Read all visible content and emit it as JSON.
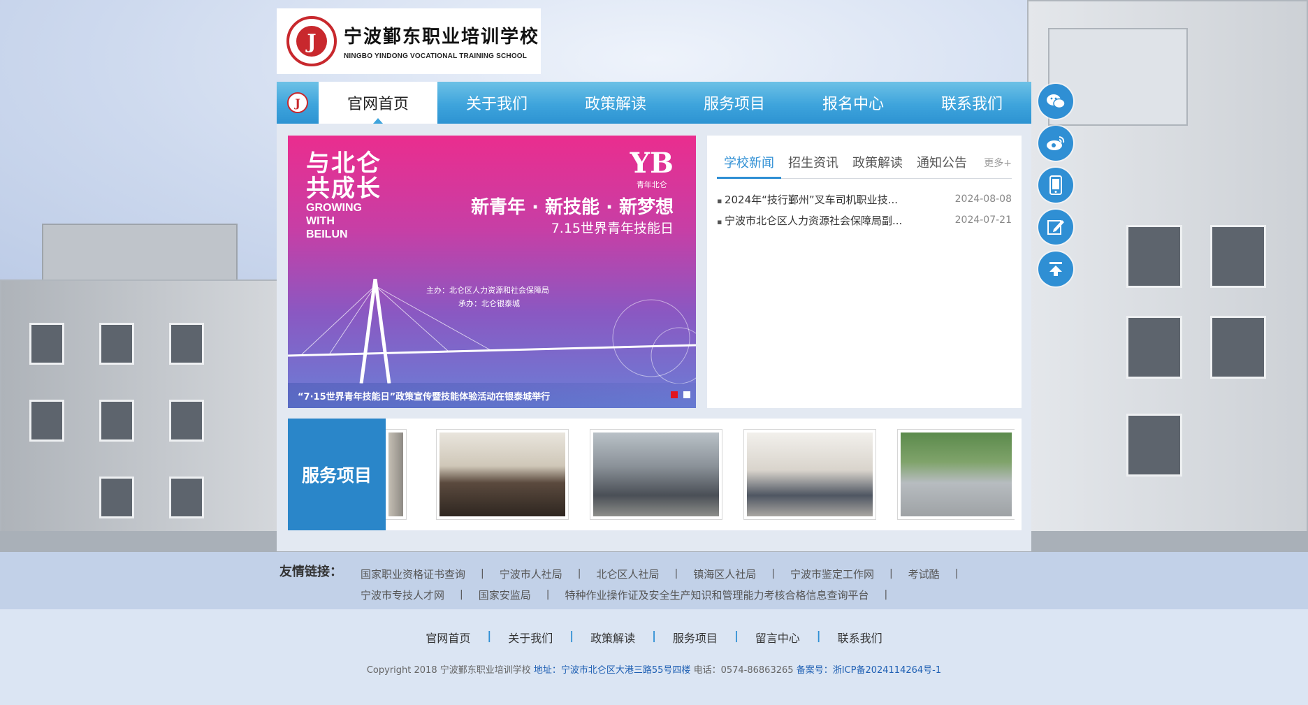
{
  "logo": {
    "emblem_letter": "J",
    "name_cn": "宁波鄞东职业培训学校",
    "name_en": "NINGBO YINDONG VOCATIONAL TRAINING SCHOOL"
  },
  "nav": {
    "mini_letter": "J",
    "items": [
      {
        "label": "官网首页",
        "active": true
      },
      {
        "label": "关于我们"
      },
      {
        "label": "政策解读"
      },
      {
        "label": "服务项目"
      },
      {
        "label": "报名中心"
      },
      {
        "label": "联系我们"
      }
    ]
  },
  "banner": {
    "headline_cn_1": "与北仑",
    "headline_cn_2": "共成长",
    "headline_en_1": "GROWING",
    "headline_en_2": "WITH",
    "headline_en_3": "BEILUN",
    "brand_mark": "YB",
    "brand_sub": "青年北仑",
    "slogan": "新青年 · 新技能 · 新梦想",
    "event_date": "7.15世界青年技能日",
    "host": "主办：北仑区人力资源和社会保障局",
    "organizer": "承办：北仑银泰城",
    "caption": "“7·15世界青年技能日”政策宣传暨技能体验活动在银泰城举行",
    "slide_count": 2,
    "active_slide": 1
  },
  "news": {
    "tabs": [
      "学校新闻",
      "招生资讯",
      "政策解读",
      "通知公告"
    ],
    "active_tab": 0,
    "more": "更多+",
    "items": [
      {
        "title": "2024年“技行鄞州”叉车司机职业技...",
        "date": "2024-08-08"
      },
      {
        "title": "宁波市北仑区人力资源社会保障局副...",
        "date": "2024-07-21"
      }
    ]
  },
  "services": {
    "label": "服务项目"
  },
  "side_tools": [
    "wechat-icon",
    "weibo-icon",
    "mobile-icon",
    "edit-icon",
    "back-to-top-icon"
  ],
  "links": {
    "title": "友情链接：",
    "row1": [
      "国家职业资格证书查询",
      "宁波市人社局",
      "北仑区人社局",
      "镇海区人社局",
      "宁波市鉴定工作网",
      "考试酷"
    ],
    "row2": [
      "宁波市专技人才网",
      "国家安监局",
      "特种作业操作证及安全生产知识和管理能力考核合格信息查询平台"
    ]
  },
  "footer": {
    "nav": [
      "官网首页",
      "关于我们",
      "政策解读",
      "服务项目",
      "留言中心",
      "联系我们"
    ],
    "copyright": "Copyright 2018 宁波鄞东职业培训学校",
    "address_label": "地址：",
    "address": "宁波市北仑区大港三路55号四楼",
    "phone_label": "电话：",
    "phone": "0574-86863265",
    "icp_label": "备案号：",
    "icp": "浙ICP备2024114264号-1"
  },
  "colors": {
    "nav_blue": "#3ea4dc",
    "accent_blue": "#2f8fd4",
    "service_blue": "#2a86c9",
    "brand_red": "#c8282d"
  }
}
